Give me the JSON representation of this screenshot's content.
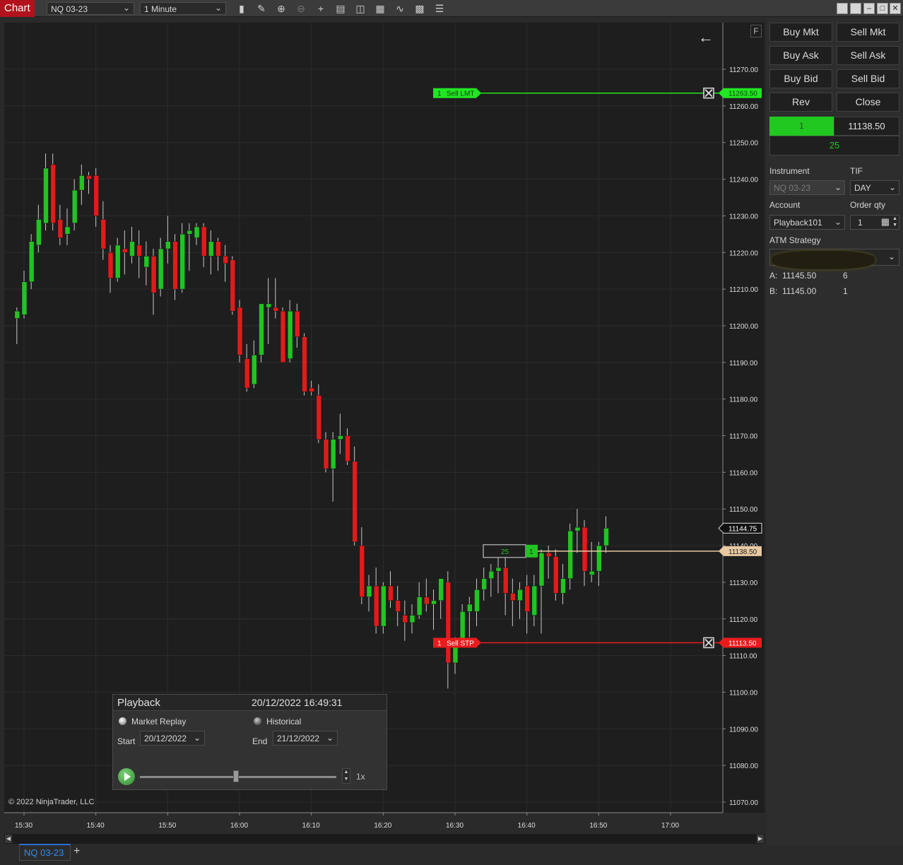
{
  "toolbar": {
    "chart_tab": "Chart",
    "instrument": "NQ 03-23",
    "interval": "1 Minute",
    "icons": [
      "bar-type-icon",
      "draw-pencil-icon",
      "zoom-in-icon",
      "zoom-out-icon",
      "crosshair-icon",
      "data-box-icon",
      "chart-trader-icon",
      "indicators-icon",
      "strategies-icon",
      "templates-icon",
      "properties-icon"
    ]
  },
  "chart": {
    "f_button": "F",
    "copyright": "© 2022 NinjaTrader, LLC",
    "price_ticks": [
      "11270.00",
      "11260.00",
      "11250.00",
      "11240.00",
      "11230.00",
      "11220.00",
      "11210.00",
      "11200.00",
      "11190.00",
      "11180.00",
      "11170.00",
      "11160.00",
      "11150.00",
      "11140.00",
      "11130.00",
      "11120.00",
      "11110.00",
      "11100.00",
      "11090.00",
      "11080.00",
      "11070.00"
    ],
    "time_ticks": [
      "15:30",
      "15:40",
      "15:50",
      "16:00",
      "16:10",
      "16:20",
      "16:30",
      "16:40",
      "16:50",
      "17:00"
    ],
    "sell_lmt_order": {
      "qty": "1",
      "label": "Sell LMT",
      "price": "11263.50",
      "color": "#22e622"
    },
    "sell_stp_order": {
      "qty": "1",
      "label": "Sell STP",
      "price": "11113.50",
      "color": "#e81c1c"
    },
    "last_price": "11144.75",
    "position": {
      "pnl_ticks": "25",
      "qty": "1",
      "price": "11138.50"
    },
    "colors": {
      "up": "#22c322",
      "down": "#e01b1b",
      "background": "#1e1e1e",
      "grid": "#2c2c2c",
      "position_line": "#e9c9a2"
    }
  },
  "chart_data": {
    "type": "candlestick",
    "instrument": "NQ 03-23",
    "interval": "1 Minute",
    "ylim": [
      11065,
      11275
    ],
    "x_range": [
      "15:28",
      "17:08"
    ],
    "candles": [
      {
        "t": "15:29",
        "o": 11202,
        "h": 11205,
        "l": 11195,
        "c": 11204
      },
      {
        "t": "15:30",
        "o": 11203,
        "h": 11215,
        "l": 11202,
        "c": 11212
      },
      {
        "t": "15:31",
        "o": 11212,
        "h": 11225,
        "l": 11210,
        "c": 11223
      },
      {
        "t": "15:32",
        "o": 11222,
        "h": 11233,
        "l": 11220,
        "c": 11229
      },
      {
        "t": "15:33",
        "o": 11228,
        "h": 11247,
        "l": 11226,
        "c": 11243
      },
      {
        "t": "15:34",
        "o": 11244,
        "h": 11247,
        "l": 11226,
        "c": 11228
      },
      {
        "t": "15:35",
        "o": 11229,
        "h": 11233,
        "l": 11222,
        "c": 11224
      },
      {
        "t": "15:36",
        "o": 11225,
        "h": 11232,
        "l": 11222,
        "c": 11227
      },
      {
        "t": "15:37",
        "o": 11228,
        "h": 11240,
        "l": 11226,
        "c": 11237
      },
      {
        "t": "15:38",
        "o": 11237,
        "h": 11244,
        "l": 11233,
        "c": 11241
      },
      {
        "t": "15:39",
        "o": 11241,
        "h": 11242,
        "l": 11236,
        "c": 11240
      },
      {
        "t": "15:40",
        "o": 11241,
        "h": 11243,
        "l": 11227,
        "c": 11230
      },
      {
        "t": "15:41",
        "o": 11229,
        "h": 11234,
        "l": 11218,
        "c": 11221
      },
      {
        "t": "15:42",
        "o": 11220,
        "h": 11222,
        "l": 11209,
        "c": 11213
      },
      {
        "t": "15:43",
        "o": 11213,
        "h": 11224,
        "l": 11212,
        "c": 11222
      },
      {
        "t": "15:44",
        "o": 11221,
        "h": 11226,
        "l": 11214,
        "c": 11220
      },
      {
        "t": "15:45",
        "o": 11219,
        "h": 11227,
        "l": 11217,
        "c": 11223
      },
      {
        "t": "15:46",
        "o": 11222,
        "h": 11226,
        "l": 11213,
        "c": 11219
      },
      {
        "t": "15:47",
        "o": 11216,
        "h": 11223,
        "l": 11211,
        "c": 11219
      },
      {
        "t": "15:48",
        "o": 11219,
        "h": 11221,
        "l": 11203,
        "c": 11209
      },
      {
        "t": "15:49",
        "o": 11210,
        "h": 11224,
        "l": 11208,
        "c": 11221
      },
      {
        "t": "15:50",
        "o": 11221,
        "h": 11230,
        "l": 11217,
        "c": 11223
      },
      {
        "t": "15:51",
        "o": 11223,
        "h": 11225,
        "l": 11207,
        "c": 11210
      },
      {
        "t": "15:52",
        "o": 11210,
        "h": 11228,
        "l": 11209,
        "c": 11225
      },
      {
        "t": "15:53",
        "o": 11225,
        "h": 11228,
        "l": 11215,
        "c": 11226
      },
      {
        "t": "15:54",
        "o": 11224,
        "h": 11228,
        "l": 11222,
        "c": 11227
      },
      {
        "t": "15:55",
        "o": 11227,
        "h": 11228,
        "l": 11216,
        "c": 11219
      },
      {
        "t": "15:56",
        "o": 11219,
        "h": 11226,
        "l": 11214,
        "c": 11223
      },
      {
        "t": "15:57",
        "o": 11223,
        "h": 11224,
        "l": 11215,
        "c": 11219
      },
      {
        "t": "15:58",
        "o": 11219,
        "h": 11222,
        "l": 11212,
        "c": 11217
      },
      {
        "t": "15:59",
        "o": 11218,
        "h": 11219,
        "l": 11203,
        "c": 11204
      },
      {
        "t": "16:00",
        "o": 11205,
        "h": 11207,
        "l": 11190,
        "c": 11192
      },
      {
        "t": "16:01",
        "o": 11191,
        "h": 11195,
        "l": 11182,
        "c": 11183
      },
      {
        "t": "16:02",
        "o": 11184,
        "h": 11196,
        "l": 11183,
        "c": 11192
      },
      {
        "t": "16:03",
        "o": 11192,
        "h": 11206,
        "l": 11190,
        "c": 11206
      },
      {
        "t": "16:04",
        "o": 11205,
        "h": 11213,
        "l": 11195,
        "c": 11206
      },
      {
        "t": "16:05",
        "o": 11205,
        "h": 11213,
        "l": 11202,
        "c": 11204
      },
      {
        "t": "16:06",
        "o": 11204,
        "h": 11205,
        "l": 11190,
        "c": 11190
      },
      {
        "t": "16:07",
        "o": 11191,
        "h": 11207,
        "l": 11190,
        "c": 11204
      },
      {
        "t": "16:08",
        "o": 11204,
        "h": 11206,
        "l": 11194,
        "c": 11197
      },
      {
        "t": "16:09",
        "o": 11197,
        "h": 11198,
        "l": 11181,
        "c": 11182
      },
      {
        "t": "16:10",
        "o": 11183,
        "h": 11185,
        "l": 11181,
        "c": 11182
      },
      {
        "t": "16:11",
        "o": 11181,
        "h": 11184,
        "l": 11168,
        "c": 11169
      },
      {
        "t": "16:12",
        "o": 11169,
        "h": 11171,
        "l": 11160,
        "c": 11161
      },
      {
        "t": "16:13",
        "o": 11161,
        "h": 11171,
        "l": 11152,
        "c": 11169
      },
      {
        "t": "16:14",
        "o": 11169,
        "h": 11176,
        "l": 11165,
        "c": 11170
      },
      {
        "t": "16:15",
        "o": 11170,
        "h": 11172,
        "l": 11162,
        "c": 11163
      },
      {
        "t": "16:16",
        "o": 11163,
        "h": 11167,
        "l": 11140,
        "c": 11141
      },
      {
        "t": "16:17",
        "o": 11140,
        "h": 11145,
        "l": 11124,
        "c": 11126
      },
      {
        "t": "16:18",
        "o": 11126,
        "h": 11132,
        "l": 11122,
        "c": 11129
      },
      {
        "t": "16:19",
        "o": 11129,
        "h": 11134,
        "l": 11116,
        "c": 11118
      },
      {
        "t": "16:20",
        "o": 11118,
        "h": 11130,
        "l": 11116,
        "c": 11129
      },
      {
        "t": "16:21",
        "o": 11129,
        "h": 11133,
        "l": 11123,
        "c": 11125
      },
      {
        "t": "16:22",
        "o": 11125,
        "h": 11129,
        "l": 11118,
        "c": 11122
      },
      {
        "t": "16:23",
        "o": 11121,
        "h": 11125,
        "l": 11114,
        "c": 11119
      },
      {
        "t": "16:24",
        "o": 11119,
        "h": 11124,
        "l": 11116,
        "c": 11121
      },
      {
        "t": "16:25",
        "o": 11121,
        "h": 11130,
        "l": 11120,
        "c": 11126
      },
      {
        "t": "16:26",
        "o": 11126,
        "h": 11131,
        "l": 11122,
        "c": 11124
      },
      {
        "t": "16:27",
        "o": 11124,
        "h": 11128,
        "l": 11117,
        "c": 11125
      },
      {
        "t": "16:28",
        "o": 11125,
        "h": 11131,
        "l": 11120,
        "c": 11131
      },
      {
        "t": "16:29",
        "o": 11130,
        "h": 11133,
        "l": 11101,
        "c": 11108
      },
      {
        "t": "16:30",
        "o": 11108,
        "h": 11115,
        "l": 11105,
        "c": 11113
      },
      {
        "t": "16:31",
        "o": 11114,
        "h": 11124,
        "l": 11113,
        "c": 11122
      },
      {
        "t": "16:32",
        "o": 11122,
        "h": 11126,
        "l": 11115,
        "c": 11124
      },
      {
        "t": "16:33",
        "o": 11122,
        "h": 11131,
        "l": 11118,
        "c": 11128
      },
      {
        "t": "16:34",
        "o": 11128,
        "h": 11134,
        "l": 11125,
        "c": 11131
      },
      {
        "t": "16:35",
        "o": 11131,
        "h": 11135,
        "l": 11126,
        "c": 11133
      },
      {
        "t": "16:36",
        "o": 11133,
        "h": 11137,
        "l": 11127,
        "c": 11134
      },
      {
        "t": "16:37",
        "o": 11134,
        "h": 11137,
        "l": 11121,
        "c": 11127
      },
      {
        "t": "16:38",
        "o": 11127,
        "h": 11131,
        "l": 11118,
        "c": 11125
      },
      {
        "t": "16:39",
        "o": 11125,
        "h": 11130,
        "l": 11120,
        "c": 11128
      },
      {
        "t": "16:40",
        "o": 11129,
        "h": 11132,
        "l": 11116,
        "c": 11122
      },
      {
        "t": "16:41",
        "o": 11121,
        "h": 11132,
        "l": 11118,
        "c": 11129
      },
      {
        "t": "16:42",
        "o": 11129,
        "h": 11139,
        "l": 11116,
        "c": 11138
      },
      {
        "t": "16:43",
        "o": 11138,
        "h": 11140,
        "l": 11131,
        "c": 11137
      },
      {
        "t": "16:44",
        "o": 11137,
        "h": 11139,
        "l": 11125,
        "c": 11127
      },
      {
        "t": "16:45",
        "o": 11127,
        "h": 11135,
        "l": 11124,
        "c": 11131
      },
      {
        "t": "16:46",
        "o": 11131,
        "h": 11146,
        "l": 11128,
        "c": 11144
      },
      {
        "t": "16:47",
        "o": 11144,
        "h": 11150,
        "l": 11138,
        "c": 11145
      },
      {
        "t": "16:48",
        "o": 11145,
        "h": 11147,
        "l": 11129,
        "c": 11133
      },
      {
        "t": "16:49",
        "o": 11132,
        "h": 11141,
        "l": 11130,
        "c": 11133
      },
      {
        "t": "16:50",
        "o": 11133,
        "h": 11141,
        "l": 11129,
        "c": 11140
      },
      {
        "t": "16:51",
        "o": 11140,
        "h": 11148,
        "l": 11138,
        "c": 11144.75
      }
    ]
  },
  "playback": {
    "title": "Playback",
    "timestamp": "20/12/2022 16:49:31",
    "market_replay_label": "Market Replay",
    "historical_label": "Historical",
    "start_label": "Start",
    "start_value": "20/12/2022",
    "end_label": "End",
    "end_value": "21/12/2022",
    "speed": "1x",
    "slider_position_fraction": 0.49
  },
  "tabs": {
    "active": "NQ 03-23",
    "add": "+"
  },
  "chart_trader": {
    "buttons": [
      "Buy Mkt",
      "Sell Mkt",
      "Buy Ask",
      "Sell Ask",
      "Buy Bid",
      "Sell Bid",
      "Rev",
      "Close"
    ],
    "position_qty": "1",
    "position_price": "11138.50",
    "unrealized": "25",
    "instrument_label": "Instrument",
    "instrument_value": "NQ 03-23",
    "tif_label": "TIF",
    "tif_value": "DAY",
    "account_label": "Account",
    "account_value": "Playback101",
    "order_qty_label": "Order qty",
    "order_qty_value": "1",
    "atm_label": "ATM Strategy",
    "ask_label": "A:",
    "ask_price": "11145.50",
    "ask_size": "6",
    "bid_label": "B:",
    "bid_price": "11145.00",
    "bid_size": "1"
  }
}
